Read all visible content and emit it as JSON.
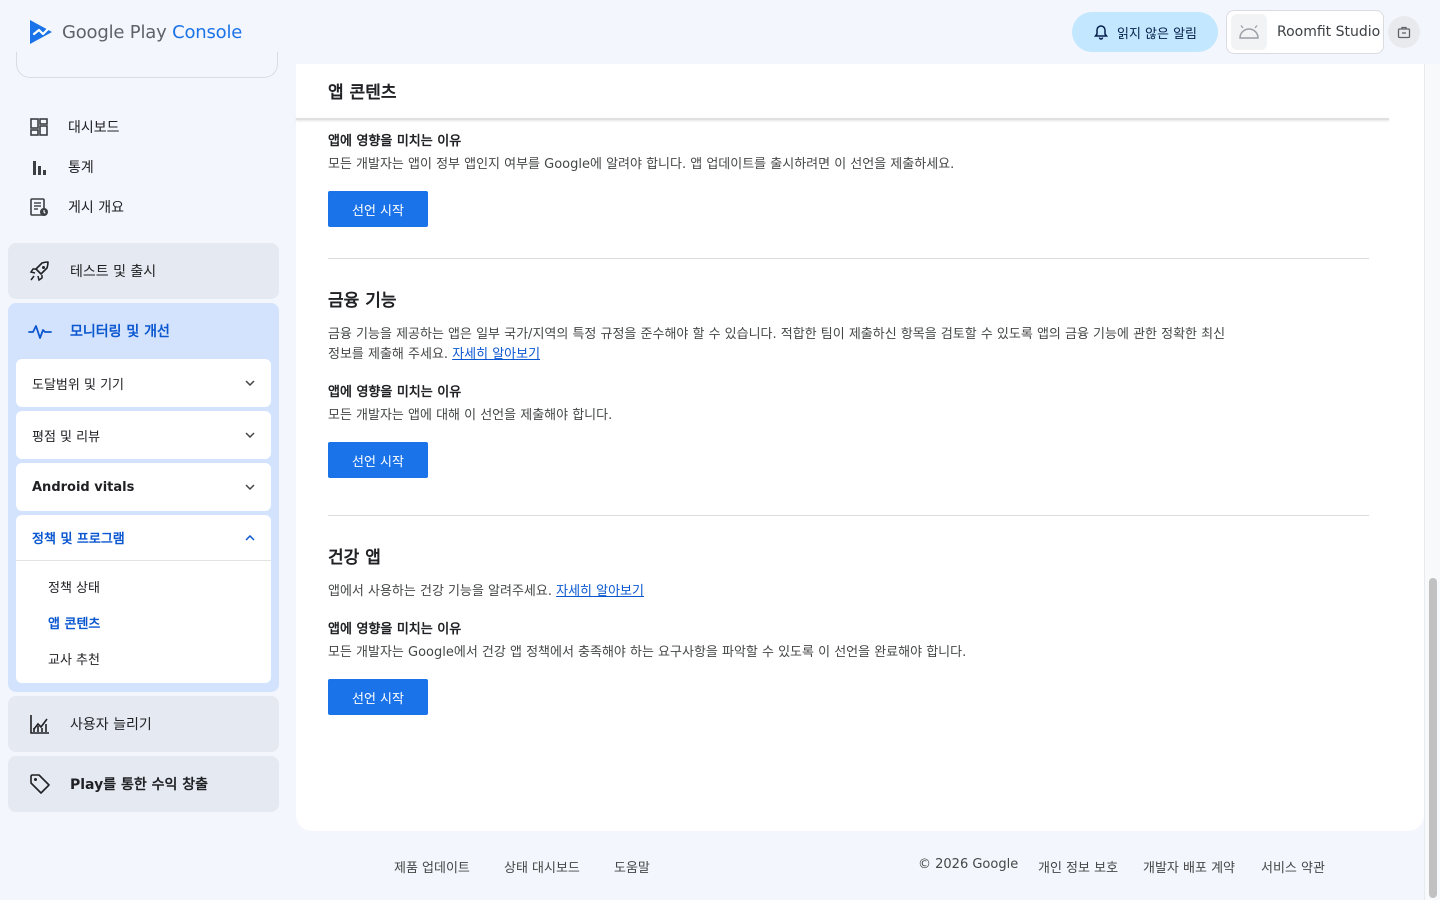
{
  "header": {
    "logo_text_main": "Google Play",
    "logo_text_accent": "Console",
    "alerts_label": "읽지 않은 알림",
    "account_name": "Roomfit Studio"
  },
  "sidebar": {
    "nav": [
      {
        "label": "대시보드",
        "icon": "dashboard-icon"
      },
      {
        "label": "통계",
        "icon": "bar-chart-icon"
      },
      {
        "label": "게시 개요",
        "icon": "publishing-overview-icon"
      }
    ],
    "test_release": "테스트 및 출시",
    "monitor": {
      "label": "모니터링 및 개선",
      "items": [
        {
          "label": "도달범위 및 기기"
        },
        {
          "label": "평점 및 리뷰"
        },
        {
          "label": "Android vitals"
        }
      ],
      "policy": {
        "label": "정책 및 프로그램",
        "leaves": [
          {
            "label": "정책 상태"
          },
          {
            "label": "앱 콘텐츠"
          },
          {
            "label": "교사 추천"
          }
        ]
      }
    },
    "grow_users": "사용자 늘리기",
    "monetize": "Play를 통한 수익 창출"
  },
  "main": {
    "page_title": "앱 콘텐츠",
    "sections": [
      {
        "title": "",
        "why_title": "앱에 영향을 미치는 이유",
        "why_desc": "모든 개발자는 앱이 정부 앱인지 여부를 Google에 알려야 합니다. 앱 업데이트를 출시하려면 이 선언을 제출하세요.",
        "button": "선언 시작"
      },
      {
        "title": "금융 기능",
        "desc": "금융 기능을 제공하는 앱은 일부 국가/지역의 특정 규정을 준수해야 할 수 있습니다. 적합한 팀이 제출하신 항목을 검토할 수 있도록 앱의 금융 기능에 관한 정확한 최신 정보를 제출해 주세요.",
        "link": "자세히 알아보기",
        "why_title": "앱에 영향을 미치는 이유",
        "why_desc": "모든 개발자는 앱에 대해 이 선언을 제출해야 합니다.",
        "button": "선언 시작"
      },
      {
        "title": "건강 앱",
        "desc": "앱에서 사용하는 건강 기능을 알려주세요.",
        "link": "자세히 알아보기",
        "why_title": "앱에 영향을 미치는 이유",
        "why_desc": "모든 개발자는 Google에서 건강 앱 정책에서 충족해야 하는 요구사항을 파악할 수 있도록 이 선언을 완료해야 합니다.",
        "button": "선언 시작"
      }
    ]
  },
  "footer": {
    "links_left": [
      "제품 업데이트",
      "상태 대시보드",
      "도움말"
    ],
    "copyright": "© 2026 Google",
    "links_right": [
      "개인 정보 보호",
      "개발자 배포 계약",
      "서비스 약관"
    ]
  },
  "colors": {
    "accent": "#1a73e8",
    "active_text": "#0b57d0",
    "active_section_bg": "#d3e3fd",
    "alerts_bg": "#c2e7ff"
  }
}
